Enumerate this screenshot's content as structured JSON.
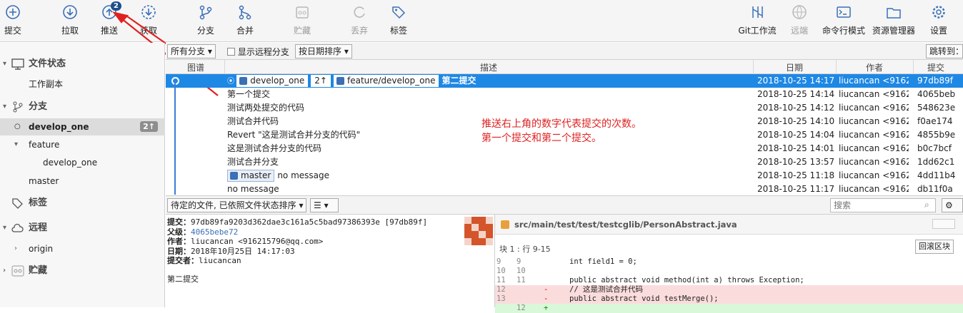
{
  "toolbar": {
    "commit": "提交",
    "pull": "拉取",
    "push": "推送",
    "push_badge": "2",
    "fetch": "获取",
    "branch": "分支",
    "merge": "合并",
    "stash": "贮藏",
    "discard": "丢弃",
    "tag": "标签",
    "gitflow": "Git工作流",
    "remote": "远端",
    "terminal": "命令行模式",
    "explorer": "资源管理器",
    "settings": "设置"
  },
  "sidebar": {
    "file_status": "文件状态",
    "working_copy": "工作副本",
    "branches": "分支",
    "develop_one": "develop_one",
    "develop_one_count": "2↑",
    "feature": "feature",
    "feature_develop_one": "develop_one",
    "master": "master",
    "tags": "标签",
    "remotes": "远程",
    "origin": "origin",
    "stashes": "贮藏"
  },
  "filter": {
    "all_branches": "所有分支",
    "show_remote": "显示远程分支",
    "sort": "按日期排序",
    "jump": "跳转到："
  },
  "columns": {
    "graph": "图谱",
    "desc": "描述",
    "date": "日期",
    "author": "作者",
    "commit": "提交"
  },
  "commits": [
    {
      "tags": [
        "develop_one",
        "2↑",
        "feature/develop_one"
      ],
      "desc": "第二提交",
      "date": "2018-10-25 14:17",
      "author": "liucancan <91621",
      "hash": "97db89f"
    },
    {
      "desc": "第一个提交",
      "date": "2018-10-25 14:14",
      "author": "liucancan <91621",
      "hash": "4065beb"
    },
    {
      "desc": "测试两处提交的代码",
      "date": "2018-10-25 14:12",
      "author": "liucancan <91621",
      "hash": "548623e"
    },
    {
      "desc": "测试合并代码",
      "date": "2018-10-25 14:10",
      "author": "liucancan <91621",
      "hash": "f0ae174"
    },
    {
      "desc": "Revert \"这是测试合并分支的代码\"",
      "date": "2018-10-25 14:04",
      "author": "liucancan <91621",
      "hash": "4855b9e"
    },
    {
      "desc": "这是测试合并分支的代码",
      "date": "2018-10-25 14:01",
      "author": "liucancan <91621",
      "hash": "b0c7bcf"
    },
    {
      "desc": "测试合并分支",
      "date": "2018-10-25 13:57",
      "author": "liucancan <91621",
      "hash": "1dd62c1"
    },
    {
      "tags": [
        "master"
      ],
      "desc": "no message",
      "date": "2018-10-25 11:18",
      "author": "liucancan <91621",
      "hash": "4dd11b4"
    },
    {
      "desc": "no message",
      "date": "2018-10-25 11:17",
      "author": "liucancan <91621",
      "hash": "db11f0a"
    }
  ],
  "annotation": [
    "推送右上角的数字代表提交的次数。",
    "第一个提交和第二个提交。"
  ],
  "bottombar": {
    "pending": "待定的文件, 已依照文件状态排序",
    "search_placeholder": "搜索"
  },
  "details": {
    "commit_label": "提交：",
    "commit_value": "97db89fa9203d362dae3c161a5c5bad97386393e [97db89f]",
    "parent_label": "父级：",
    "parent_value": "4065bebe72",
    "author_label": "作者：",
    "author_value": "liucancan <916215796@qq.com>",
    "date_label": "日期：",
    "date_value": "2018年10月25日 14:17:03",
    "committer_label": "提交者：",
    "committer_value": "liucancan",
    "message": "第二提交"
  },
  "diff": {
    "file": "src/main/test/test/testcglib/PersonAbstract.java",
    "hunk": "块 1 : 行 9-15",
    "hunk_button": "回滚区块",
    "lines": [
      {
        "n1": "9",
        "n2": "9",
        "mark": "",
        "code": "int field1 = 0;",
        "type": ""
      },
      {
        "n1": "10",
        "n2": "10",
        "mark": "",
        "code": "",
        "type": ""
      },
      {
        "n1": "11",
        "n2": "11",
        "mark": "",
        "code": "public abstract void method(int a) throws Exception;",
        "type": ""
      },
      {
        "n1": "12",
        "n2": "",
        "mark": "-",
        "code": "// 这是测试合并代码",
        "type": "rm"
      },
      {
        "n1": "13",
        "n2": "",
        "mark": "-",
        "code": "public abstract void testMerge();",
        "type": "rm"
      },
      {
        "n1": "",
        "n2": "12",
        "mark": "+",
        "code": "",
        "type": "ad"
      }
    ]
  },
  "colors": {
    "selection": "#1e88e5",
    "accent": "#3b6fb6",
    "annotation": "#e02020"
  }
}
